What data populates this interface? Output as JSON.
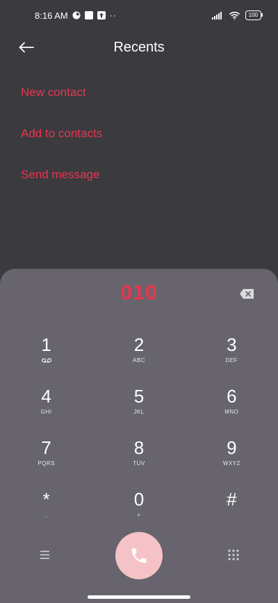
{
  "status_bar": {
    "time": "8:16 AM",
    "dots": "··",
    "battery": "100"
  },
  "header": {
    "title": "Recents",
    "back_icon": "arrow-left-icon"
  },
  "actions": [
    {
      "label": "New contact"
    },
    {
      "label": "Add to contacts"
    },
    {
      "label": "Send message"
    }
  ],
  "dialer": {
    "number": "010",
    "keys": [
      {
        "digit": "1",
        "letters": ""
      },
      {
        "digit": "2",
        "letters": "ABC"
      },
      {
        "digit": "3",
        "letters": "DEF"
      },
      {
        "digit": "4",
        "letters": "GHI"
      },
      {
        "digit": "5",
        "letters": "JKL"
      },
      {
        "digit": "6",
        "letters": "MNO"
      },
      {
        "digit": "7",
        "letters": "PQRS"
      },
      {
        "digit": "8",
        "letters": "TUV"
      },
      {
        "digit": "9",
        "letters": "WXYZ"
      },
      {
        "digit": "*",
        "letters": ","
      },
      {
        "digit": "0",
        "letters": "+"
      },
      {
        "digit": "#",
        "letters": ""
      }
    ]
  },
  "colors": {
    "background": "#3b3a3e",
    "sheet": "#67646d",
    "accent": "#e8354f",
    "call_button": "#f4c2c7"
  }
}
